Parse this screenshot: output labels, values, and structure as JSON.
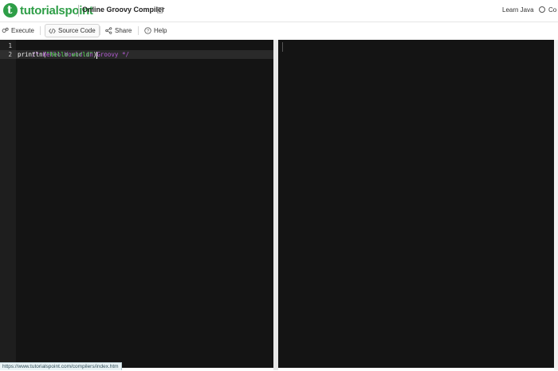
{
  "header": {
    "logo_text": "tutorialspoint",
    "logo_mark": "t",
    "title": "Online Groovy Compiler",
    "learn_link": "Learn Java",
    "right_label": "Co"
  },
  "toolbar": {
    "execute_label": "Execute",
    "source_label": "Source Code",
    "share_label": "Share",
    "help_label": "Help"
  },
  "editor": {
    "lines": [
      {
        "number": "1",
        "text": "/* Hello World in Groovy */"
      },
      {
        "number": "2",
        "fn": "println",
        "open": "(",
        "str": "\"Hello world\"",
        "close": ")"
      }
    ]
  },
  "status_bar": {
    "url": "https://www.tutorialspoint.com/compilers/index.htm"
  },
  "colors": {
    "brand": "#2e9e47",
    "editor_bg": "#141414",
    "comment": "#b65dd6",
    "string": "#5ee05e"
  }
}
